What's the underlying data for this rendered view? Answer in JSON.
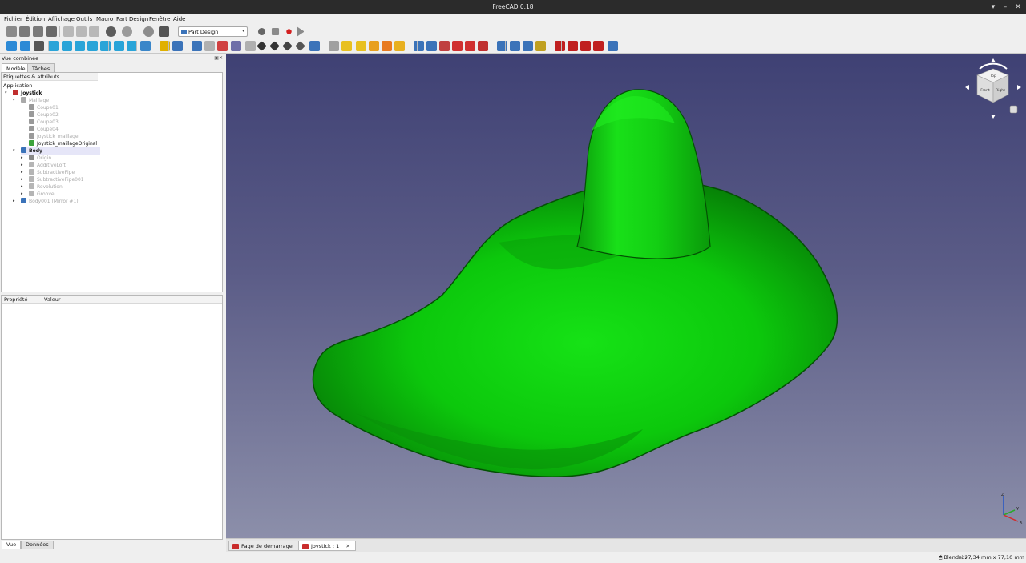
{
  "window": {
    "title": "FreeCAD 0.18"
  },
  "menu": [
    "Fichier",
    "Édition",
    "Affichage",
    "Outils",
    "Macro",
    "Part Design",
    "Fenêtre",
    "Aide"
  ],
  "workbench": {
    "selected": "Part Design"
  },
  "toolbar1_icons": [
    "new-file-icon",
    "open-file-icon",
    "save-icon",
    "print-icon",
    "cut-icon",
    "copy-icon",
    "paste-icon",
    "undo-icon",
    "redo-icon",
    "refresh-icon",
    "whats-this-icon",
    "record-macro-icon",
    "stop-macro-icon",
    "macro-editor-icon",
    "run-macro-icon"
  ],
  "toolbar2_icons": [
    "fit-all-icon",
    "fit-selection-icon",
    "draw-style-icon",
    "isometric-view-icon",
    "front-view-icon",
    "top-view-icon",
    "right-view-icon",
    "rear-view-icon",
    "bottom-view-icon",
    "left-view-icon",
    "measure-icon",
    "part-icon",
    "group-icon",
    "body-icon",
    "sketch-icon",
    "map-sketch-icon",
    "validate-sketch-icon",
    "clone-icon",
    "datum-point-icon",
    "datum-line-icon",
    "datum-plane-icon",
    "local-cs-icon",
    "shape-binder-icon",
    "subshape-binder-icon",
    "pad-icon",
    "revolution-icon",
    "additive-loft-icon",
    "additive-pipe-icon",
    "additive-primitive-icon",
    "pocket-icon",
    "hole-icon",
    "groove-icon",
    "subtractive-loft-icon",
    "subtractive-pipe-icon",
    "subtractive-primitive-icon",
    "mirrored-icon",
    "linear-pattern-icon",
    "polar-pattern-icon",
    "multitransform-icon",
    "fillet-icon",
    "chamfer-icon",
    "draft-icon",
    "thickness-icon",
    "boolean-icon"
  ],
  "panel": {
    "title": "Vue combinée",
    "tabs": [
      "Modèle",
      "Tâches"
    ],
    "tree_header": "Étiquettes & attributs",
    "application_label": "Application",
    "tree": [
      {
        "label": "Joystick",
        "icon": "document-icon"
      },
      {
        "label": "Maillage",
        "icon": "folder-icon"
      },
      {
        "label": "Coupe01",
        "icon": "mesh-icon"
      },
      {
        "label": "Coupe02",
        "icon": "mesh-icon"
      },
      {
        "label": "Coupe03",
        "icon": "mesh-icon"
      },
      {
        "label": "Coupe04",
        "icon": "mesh-icon"
      },
      {
        "label": "Joystick_maillage",
        "icon": "mesh-icon"
      },
      {
        "label": "Joystick_maillageOriginal",
        "icon": "mesh-visible-icon"
      },
      {
        "label": "Body",
        "icon": "body-icon"
      },
      {
        "label": "Origin",
        "icon": "origin-icon"
      },
      {
        "label": "AdditiveLoft",
        "icon": "additive-loft-icon"
      },
      {
        "label": "SubtractivePipe",
        "icon": "subtractive-pipe-icon"
      },
      {
        "label": "SubtractivePipe001",
        "icon": "subtractive-pipe-icon"
      },
      {
        "label": "Revolution",
        "icon": "revolution-icon"
      },
      {
        "label": "Groove",
        "icon": "groove-icon"
      },
      {
        "label": "Body001 (Mirror #1)",
        "icon": "body-icon"
      }
    ],
    "property_headers": [
      "Propriété",
      "Valeur"
    ],
    "bottom_tabs": [
      "Vue",
      "Données"
    ]
  },
  "navcube": {
    "faces": [
      "Top",
      "Front",
      "Right"
    ]
  },
  "axes": [
    "X",
    "Y",
    "Z"
  ],
  "doc_tabs": [
    {
      "label": "Page de démarrage",
      "close": "✕"
    },
    {
      "label": "Joystick : 1",
      "close": "✕"
    }
  ],
  "status": {
    "nav_style": "Blender",
    "dimensions": "127,34 mm x 77,10 mm"
  },
  "colors": {
    "model": "#13d613",
    "viewport_top": "#3f4174",
    "viewport_bottom": "#8c8faa"
  }
}
